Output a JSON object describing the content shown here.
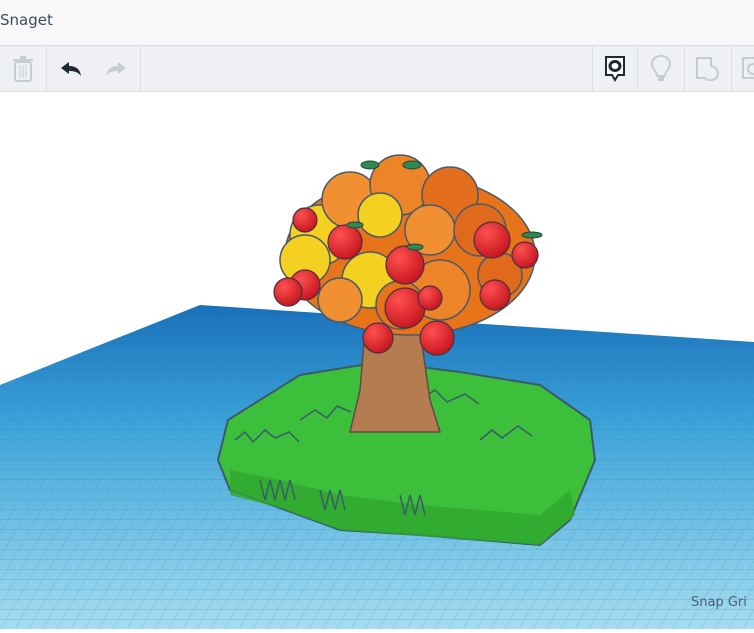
{
  "app": {
    "title": "Snaget"
  },
  "toolbar": {
    "buttons": [
      {
        "icon": "trash-icon",
        "enabled": false
      },
      {
        "icon": "undo-icon",
        "enabled": true
      },
      {
        "icon": "redo-icon",
        "enabled": false
      },
      {
        "icon": "notes-icon",
        "enabled": true
      },
      {
        "icon": "lightbulb-icon",
        "enabled": false
      },
      {
        "icon": "shape-icon",
        "enabled": false
      },
      {
        "icon": "mirror-icon",
        "enabled": false
      }
    ]
  },
  "viewport": {
    "snap_grid_label": "Snap Gri"
  },
  "colors": {
    "grid": "#2a8fd0",
    "trunk": "#b07a4f",
    "grass": "#3cc23c",
    "apple": "#e02020",
    "foliage": "#f08a20"
  }
}
